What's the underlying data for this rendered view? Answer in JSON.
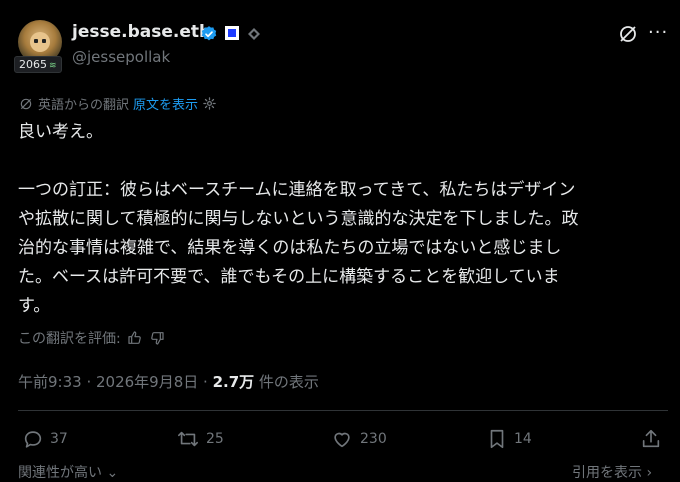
{
  "user": {
    "name": "jesse.base.eth",
    "handle": "@jessepollak",
    "score": "2065"
  },
  "translation": {
    "from_label": "英語からの翻訳",
    "show_original": "原文を表示"
  },
  "post": {
    "text": "良い考え。\n\n一つの訂正：彼らはベースチームに連絡を取ってきて、私たちはデザイン\nや拡散に関して積極的に関与しないという意識的な決定を下しました。政\n治的な事情は複雑で、結果を導くのは私たちの立場ではないと感じまし\nた。ベースは許可不要で、誰でもその上に構築することを歓迎していま\nす。"
  },
  "rating": {
    "label": "この翻訳を評価:"
  },
  "meta": {
    "time": "午前9:33 · 2026年9月8日 · ",
    "views_count": "2.7万",
    "views_label": " 件の表示"
  },
  "actions": {
    "replies": "37",
    "reposts": "25",
    "likes": "230",
    "bookmarks": "14"
  },
  "bottom": {
    "left": "関連性が高い",
    "right": "引用を表示"
  },
  "colors": {
    "background": "#000000",
    "text": "#e7e9ea",
    "muted": "#71767b",
    "link": "#1d9bf0",
    "verified": "#1d9bf0"
  }
}
